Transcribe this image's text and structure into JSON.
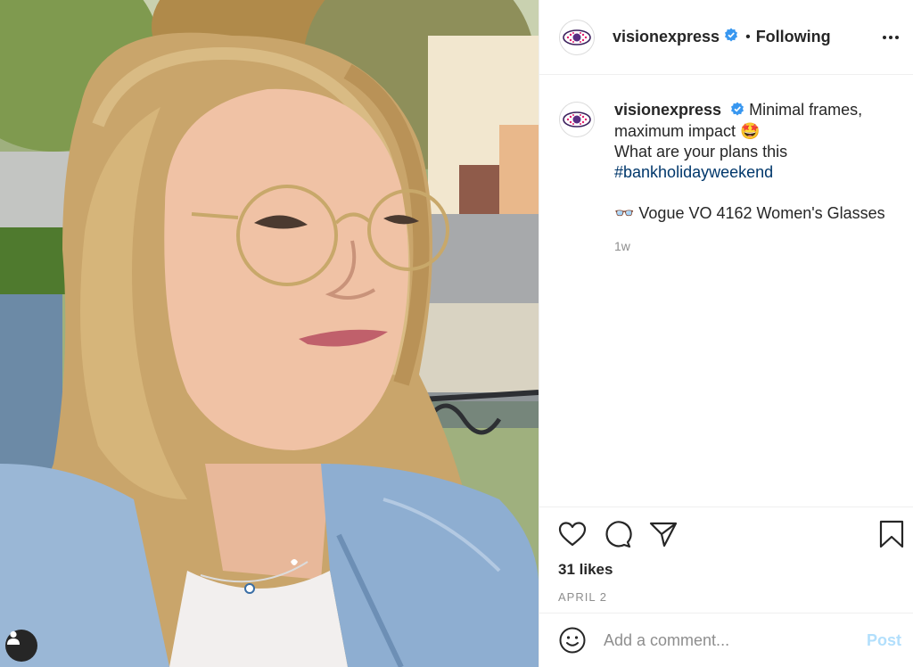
{
  "post": {
    "username": "visionexpress",
    "follow_status": "Following",
    "separator": "•",
    "caption": {
      "username": "visionexpress",
      "line1": "Minimal frames, maximum impact 🤩",
      "line2": "What are your plans this",
      "hashtag": "#bankholidayweekend",
      "product": "👓 Vogue VO 4162 Women's Glasses"
    },
    "time_ago": "1w",
    "likes": "31 likes",
    "date": "APRIL 2"
  },
  "comment": {
    "placeholder": "Add a comment...",
    "post_label": "Post"
  },
  "colors": {
    "verified": "#3897f0",
    "hashtag": "#00376b",
    "post_disabled": "#b2dffc"
  }
}
